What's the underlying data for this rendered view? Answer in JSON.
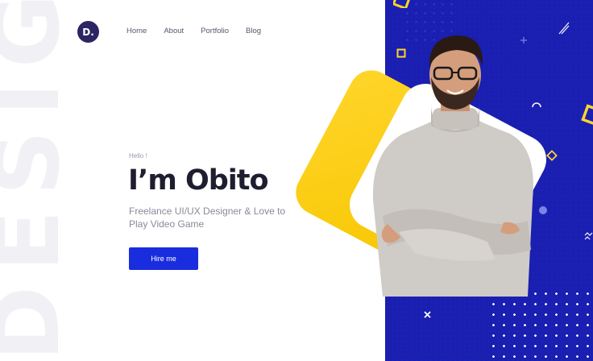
{
  "watermark": "DESIGN",
  "logo": {
    "text": "D."
  },
  "nav": {
    "items": [
      "Home",
      "About",
      "Portfolio",
      "Blog"
    ]
  },
  "hero": {
    "greeting": "Hello !",
    "title": "I’m Obito",
    "subtitle": "Freelance UI/UX Designer & Love to Play Video Game",
    "cta_label": "Hire me"
  },
  "colors": {
    "accent_blue": "#1a2dde",
    "panel_blue": "#1a1fb0",
    "yellow": "#ffd52a",
    "logo_bg": "#2c2563"
  },
  "icons": [
    "logo-badge",
    "person-photo",
    "yellow-square-icon",
    "plus-icon",
    "cross-icon",
    "diamond-icon",
    "circle-icon",
    "semicircle-icon",
    "squiggle-icon",
    "dot-grid"
  ]
}
